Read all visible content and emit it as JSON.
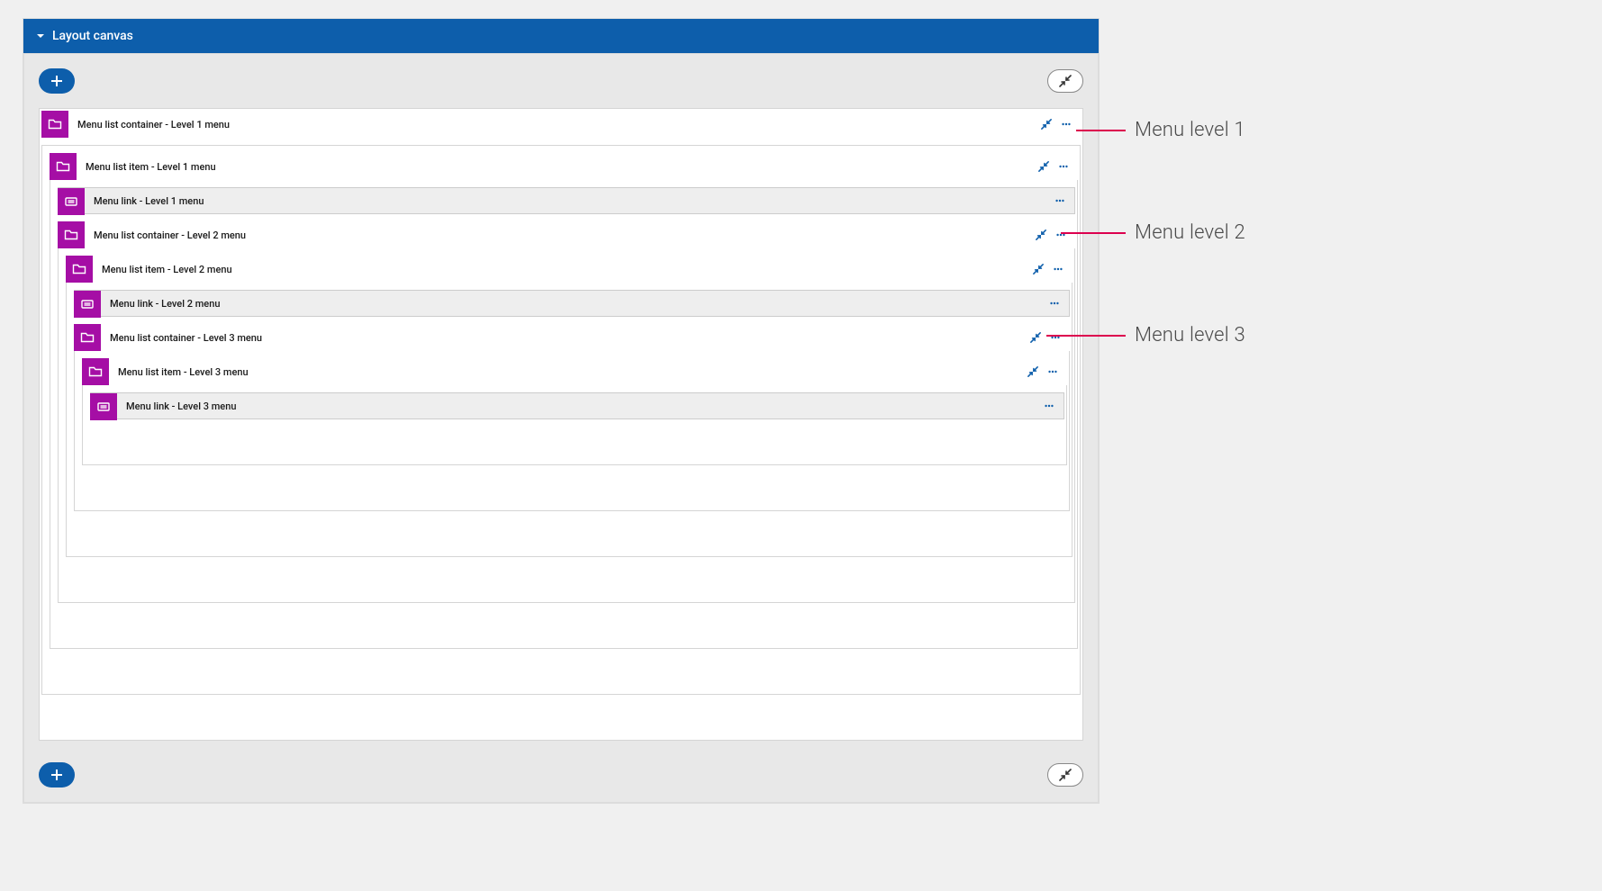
{
  "panel": {
    "title": "Layout canvas"
  },
  "tree": {
    "l1_container": "Menu list container - Level 1 menu",
    "l1_item": "Menu list item - Level 1 menu",
    "l1_link": "Menu link - Level 1 menu",
    "l2_container": "Menu list container - Level 2 menu",
    "l2_item": "Menu list item - Level 2 menu",
    "l2_link": "Menu link - Level 2 menu",
    "l3_container": "Menu list container - Level 3 menu",
    "l3_item": "Menu list item - Level 3 menu",
    "l3_link": "Menu link - Level 3 menu"
  },
  "annotations": {
    "a1": "Menu level 1",
    "a2": "Menu level 2",
    "a3": "Menu level 3"
  }
}
